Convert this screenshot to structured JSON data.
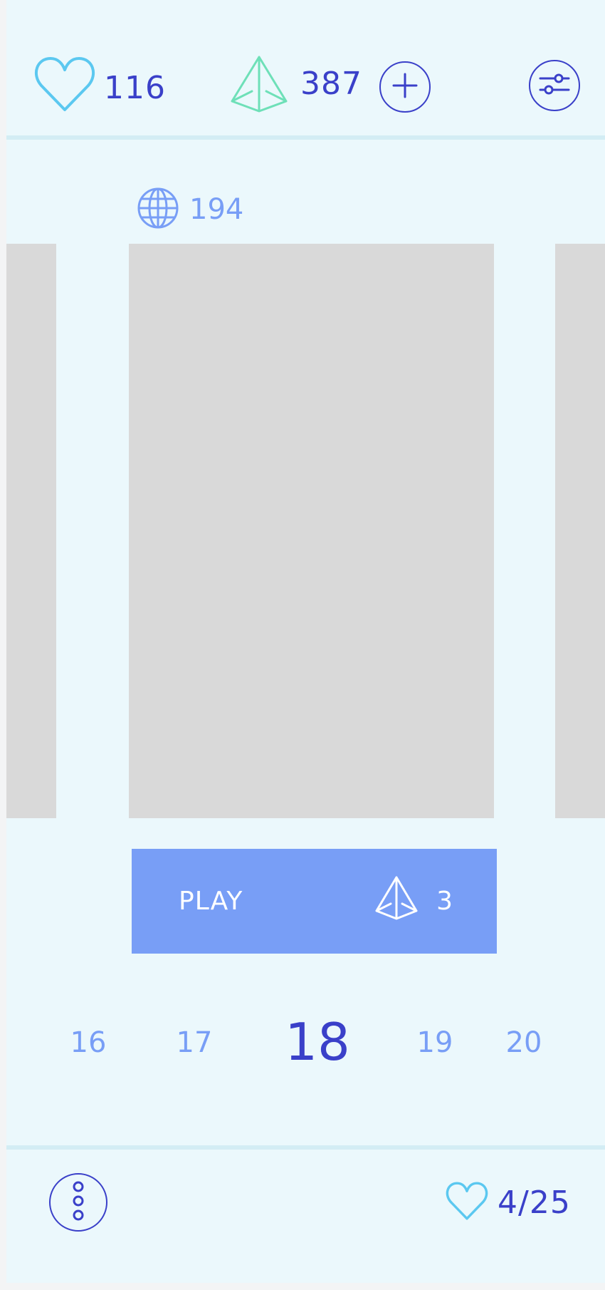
{
  "header": {
    "lives_count": "116",
    "gems_count": "387",
    "add_label": "+",
    "icons": {
      "lives": "heart-outline-icon",
      "gems": "pyramid-icon",
      "add": "plus-circle-icon",
      "settings": "sliders-icon"
    }
  },
  "main": {
    "online_count": "194",
    "online_icon": "globe-icon",
    "play_button": {
      "label": "PLAY",
      "cost": "3",
      "cost_icon": "pyramid-icon"
    },
    "levels": [
      {
        "number": "16",
        "active": false
      },
      {
        "number": "17",
        "active": false
      },
      {
        "number": "18",
        "active": true
      },
      {
        "number": "19",
        "active": false
      },
      {
        "number": "20",
        "active": false
      }
    ]
  },
  "footer": {
    "menu_icon": "more-vertical-icon",
    "lives_progress": "4/25",
    "lives_icon": "heart-outline-icon"
  },
  "colors": {
    "background": "#ebf8fc",
    "primary": "#3a40c9",
    "accent": "#789ef6",
    "heart": "#5bc8f0",
    "gem": "#6ee0b8",
    "card": "#d9d9d9",
    "divider": "#d3edf4"
  }
}
